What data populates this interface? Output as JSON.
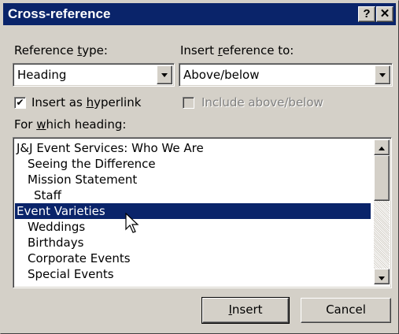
{
  "dialog": {
    "title": "Cross-reference",
    "help_glyph": "?",
    "close_glyph": "✕"
  },
  "reference_type": {
    "label_pre": "Reference ",
    "label_access": "t",
    "label_post": "ype:",
    "value": "Heading"
  },
  "insert_reference_to": {
    "label_pre": "Insert ",
    "label_access": "r",
    "label_post": "eference to:",
    "value": "Above/below"
  },
  "insert_as_hyperlink": {
    "label_pre": "Insert as ",
    "label_access": "h",
    "label_post": "yperlink",
    "checked": true,
    "check_glyph": "✔"
  },
  "include_above_below": {
    "label": "Include above/below",
    "checked": false,
    "enabled": false
  },
  "for_which_heading": {
    "label_pre": "For ",
    "label_access": "w",
    "label_post": "hich heading:",
    "items": [
      {
        "text": "J&J Event Services: Who We Are",
        "level": 1,
        "selected": false
      },
      {
        "text": "Seeing the Difference",
        "level": 2,
        "selected": false
      },
      {
        "text": "Mission Statement",
        "level": 2,
        "selected": false
      },
      {
        "text": "Staff",
        "level": 3,
        "selected": false
      },
      {
        "text": "Event Varieties",
        "level": 1,
        "selected": true
      },
      {
        "text": "Weddings",
        "level": 2,
        "selected": false
      },
      {
        "text": "Birthdays",
        "level": 2,
        "selected": false
      },
      {
        "text": "Corporate Events",
        "level": 2,
        "selected": false
      },
      {
        "text": "Special Events",
        "level": 2,
        "selected": false
      }
    ]
  },
  "buttons": {
    "insert_access": "I",
    "insert_rest": "nsert",
    "cancel": "Cancel"
  },
  "colors": {
    "title_bar": "#0a246a",
    "face": "#d4d0c8",
    "selection": "#0a246a"
  },
  "icons": {
    "cursor": "arrow-pointer-icon"
  }
}
